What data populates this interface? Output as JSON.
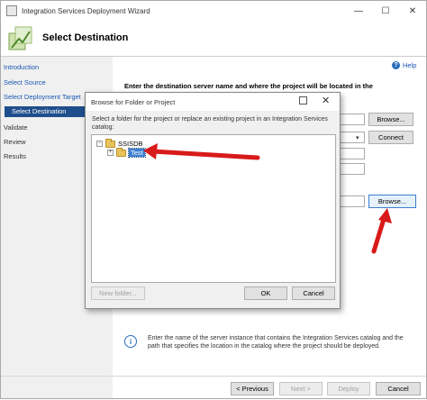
{
  "window": {
    "title": "Integration Services Deployment Wizard",
    "minimize": "—",
    "maximize": "☐",
    "close": "✕"
  },
  "header": {
    "title": "Select Destination"
  },
  "nav": {
    "items": [
      {
        "label": "Introduction"
      },
      {
        "label": "Select Source"
      },
      {
        "label": "Select Deployment Target"
      },
      {
        "label": "Select Destination"
      },
      {
        "label": "Validate"
      },
      {
        "label": "Review"
      },
      {
        "label": "Results"
      }
    ]
  },
  "help": {
    "label": "Help"
  },
  "main": {
    "instruction": "Enter the destination server name and where the project will be located in the",
    "browse_server_label": "Browse...",
    "connect_label": "Connect",
    "browse_path_label": "Browse...",
    "info_text": "Enter the name of the server instance that contains the Integration Services catalog and the path that specifies the location in the catalog where the project should be deployed."
  },
  "footer": {
    "previous": "< Previous",
    "next": "Next >",
    "deploy": "Deploy",
    "cancel": "Cancel"
  },
  "dialog": {
    "title": "Browse for Folder or Project",
    "description": "Select a folder for the project or replace an existing project in an Integration Services catalog:",
    "tree": {
      "root": "SSISDB",
      "child": "Test"
    },
    "new_folder": "New folder...",
    "ok": "OK",
    "cancel": "Cancel"
  },
  "colors": {
    "arrow": "#d91a1a",
    "selection": "#3b7fd0",
    "nav_selected": "#1f4e8c",
    "link": "#1a56b5"
  }
}
